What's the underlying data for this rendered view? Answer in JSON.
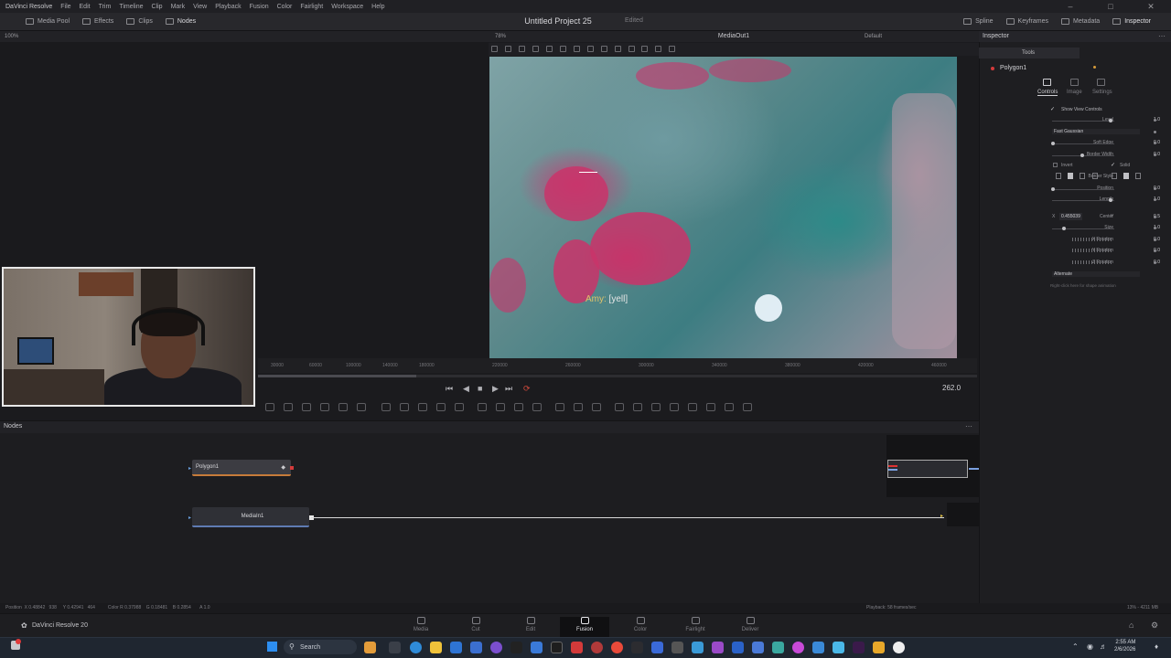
{
  "menubar": {
    "app": "DaVinci Resolve",
    "items": [
      "File",
      "Edit",
      "Trim",
      "Timeline",
      "Clip",
      "Mark",
      "View",
      "Playback",
      "Fusion",
      "Color",
      "Fairlight",
      "Workspace",
      "Help"
    ]
  },
  "toolbar": {
    "left": [
      "Media Pool",
      "Effects",
      "Clips",
      "Nodes"
    ],
    "right": [
      "Spline",
      "Keyframes",
      "Metadata",
      "Inspector"
    ],
    "project_title": "Untitled Project 25",
    "project_status": "Edited"
  },
  "viewer": {
    "title": "MediaOut1",
    "zoom": "78%",
    "zoom_left": "100%",
    "layout": "Default",
    "subtitle_speaker": "Amy:",
    "subtitle_text": " [yell]"
  },
  "timeline": {
    "ticks": [
      "30000",
      "60000",
      "100000",
      "140000",
      "180000",
      "220000",
      "260000",
      "300000",
      "340000",
      "380000",
      "420000",
      "460000"
    ],
    "frame": "262.0",
    "progress": 0.22
  },
  "nodes": {
    "panel_title": "Nodes",
    "polygon": "Polygon1",
    "media": "MediaIn1"
  },
  "inspector": {
    "title": "Inspector",
    "tools_tab": "Tools",
    "tool_name": "Polygon1",
    "tabs": [
      "Controls",
      "Image",
      "Settings"
    ],
    "show_view_controls": "Show View Controls",
    "level": {
      "label": "Level",
      "value": "1.0"
    },
    "filter": {
      "label": "Filter",
      "value": "Fast Gaussian"
    },
    "soft_edge": {
      "label": "Soft Edge",
      "value": "0.0"
    },
    "border_width": {
      "label": "Border Width",
      "value": "0.0"
    },
    "invert": "Invert",
    "solid": "Solid",
    "border_style": "Border Style",
    "position": {
      "label": "Position",
      "value": "0.0"
    },
    "length": {
      "label": "Length",
      "value": "1.0"
    },
    "center": {
      "label": "Center",
      "x_label": "X",
      "x": "0.455039",
      "y_label": "Y",
      "y": "0.5"
    },
    "size": {
      "label": "Size",
      "value": "1.0"
    },
    "x_rotation": {
      "label": "X Rotation",
      "value": "0.0"
    },
    "y_rotation": {
      "label": "Y Rotation",
      "value": "0.0"
    },
    "z_rotation": {
      "label": "Z Rotation",
      "value": "0.0"
    },
    "fill_method": {
      "label": "Fill Method",
      "value": "Alternate"
    },
    "hint": "Right-click here for shape animation"
  },
  "status": {
    "left": "Position  X 0.48842   938     Y 0.42941   464          Color R 0.37988    G 0.18481    B 0.2854       A 1.0",
    "right": "Playback: 58 frames/sec",
    "memory": "13% - 4211 MB"
  },
  "pages": {
    "brand": "DaVinci Resolve 20",
    "items": [
      "Media",
      "Cut",
      "Edit",
      "Fusion",
      "Color",
      "Fairlight",
      "Deliver"
    ]
  },
  "taskbar": {
    "search": "Search",
    "time": "2:55 AM",
    "date": "2/6/2026"
  }
}
